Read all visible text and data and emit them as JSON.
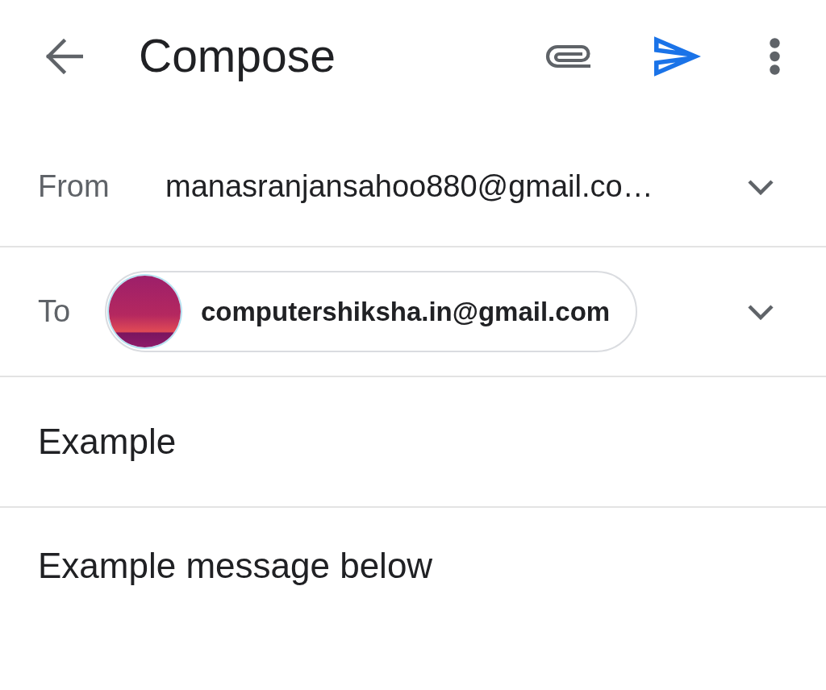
{
  "app_bar": {
    "title": "Compose"
  },
  "from": {
    "label": "From",
    "value": "manasranjansahoo880@gmail.co…"
  },
  "to": {
    "label": "To",
    "recipients": [
      {
        "email": "computershiksha.in@gmail.com"
      }
    ]
  },
  "subject": {
    "value": "Example"
  },
  "body": {
    "value": "Example message below"
  }
}
